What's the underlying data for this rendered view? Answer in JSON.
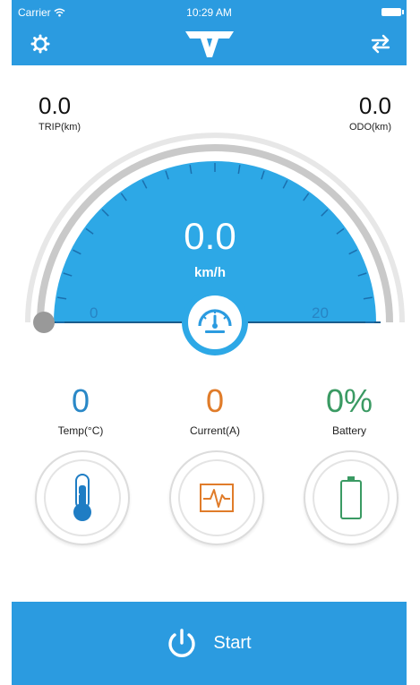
{
  "status_bar": {
    "carrier": "Carrier",
    "time": "10:29 AM"
  },
  "header": {
    "left_icon": "settings-gear-icon",
    "logo": "brand-logo",
    "right_icon": "swap-arrows-icon"
  },
  "trip": {
    "value": "0.0",
    "label": "TRIP(km)"
  },
  "odo": {
    "value": "0.0",
    "label": "ODO(km)"
  },
  "speedometer": {
    "speed": "0.0",
    "unit": "km/h",
    "min_label": "0",
    "max_label": "20",
    "speed_value": 0,
    "range": [
      0,
      20
    ]
  },
  "metrics": {
    "temp": {
      "value": "0",
      "label": "Temp(°C)"
    },
    "current": {
      "value": "0",
      "label": "Current(A)"
    },
    "battery": {
      "value": "0%",
      "label": "Battery"
    }
  },
  "start_button": {
    "label": "Start"
  },
  "colors": {
    "primary": "#2b9be0",
    "temp": "#2a88c7",
    "current": "#e07c2a",
    "battery": "#3a9a63"
  }
}
